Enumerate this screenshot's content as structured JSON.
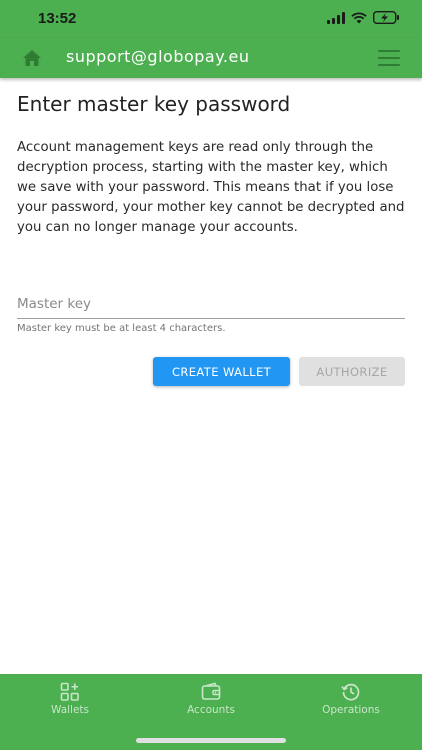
{
  "status_bar": {
    "time": "13:52"
  },
  "header": {
    "title": "support@globopay.eu",
    "home_icon": "home-icon",
    "menu_icon": "hamburger-menu-icon"
  },
  "main": {
    "title": "Enter master key password",
    "description": "Account management keys are read only through the decryption process, starting with the master key, which we save with your password. This means that if you lose your password, your mother key cannot be decrypted and you can no longer manage your accounts.",
    "master_key_input": {
      "value": "",
      "placeholder": "Master key",
      "hint": "Master key must be at least 4 characters."
    },
    "buttons": {
      "create_wallet": "CREATE WALLET",
      "authorize": "AUTHORIZE"
    }
  },
  "bottom_nav": {
    "items": [
      {
        "label": "Wallets",
        "icon": "wallets-grid-icon"
      },
      {
        "label": "Accounts",
        "icon": "wallet-icon"
      },
      {
        "label": "Operations",
        "icon": "history-icon"
      }
    ]
  },
  "colors": {
    "primary_green": "#4caf50",
    "accent_blue": "#2196f3",
    "disabled_gray": "#e0e0e0"
  }
}
